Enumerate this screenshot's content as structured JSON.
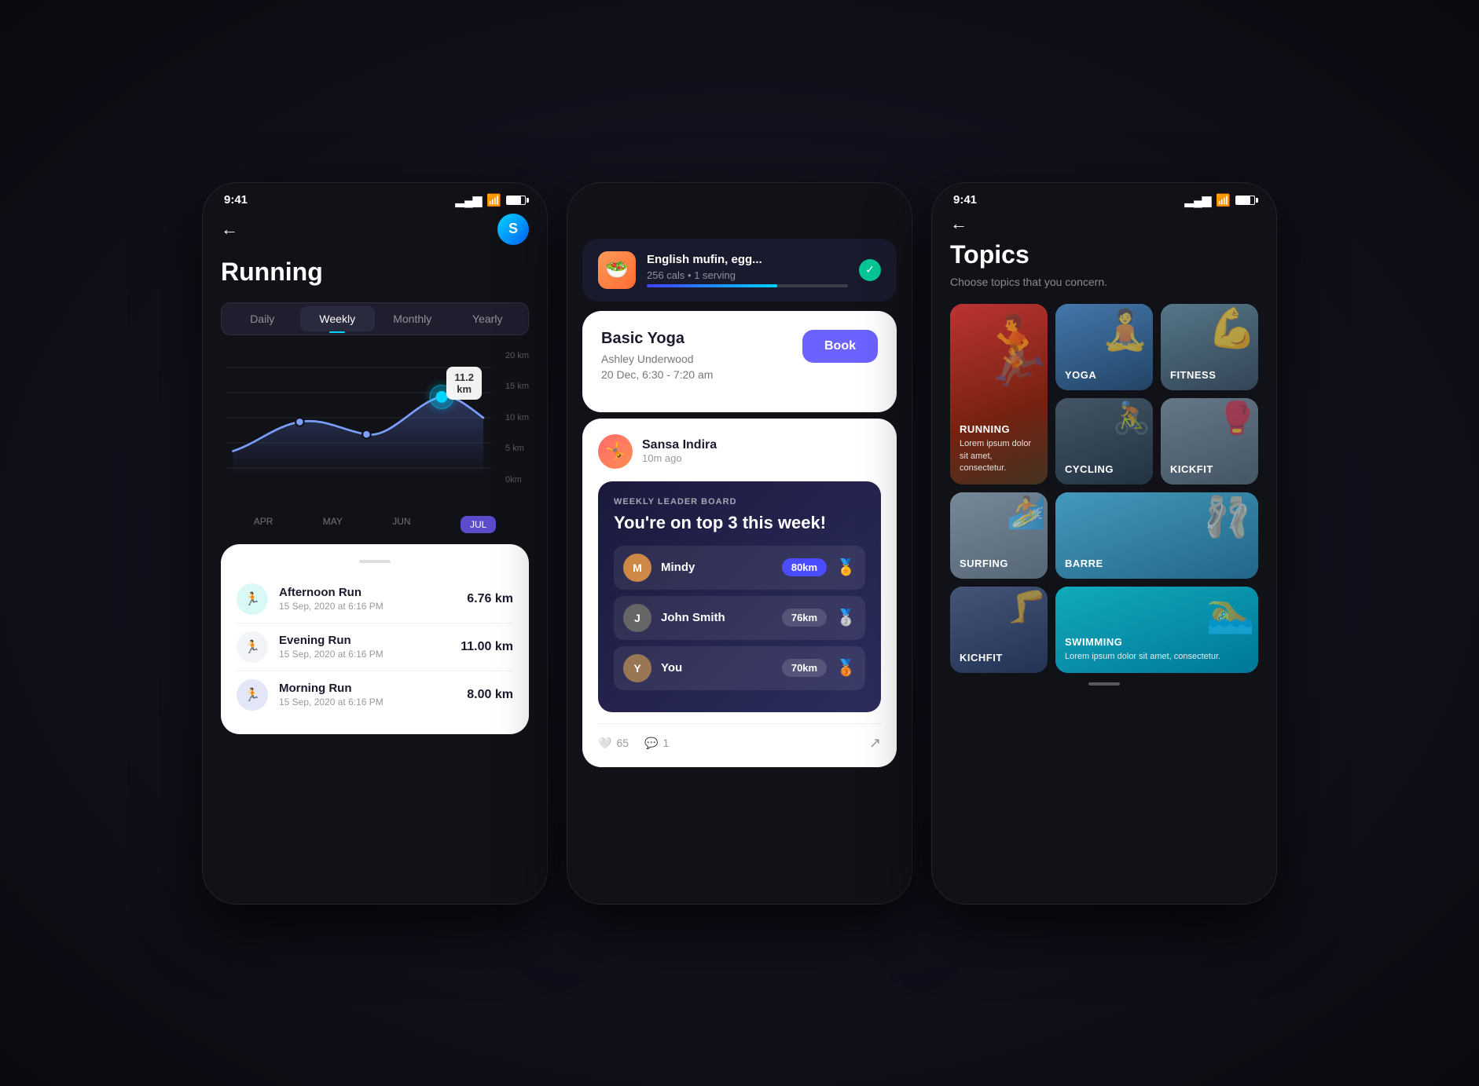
{
  "left_phone": {
    "status_time": "9:41",
    "back_label": "←",
    "logo_text": "S",
    "page_title": "Running",
    "tabs": [
      {
        "label": "Daily",
        "active": false
      },
      {
        "label": "Weekly",
        "active": true
      },
      {
        "label": "Monthly",
        "active": false
      },
      {
        "label": "Yearly",
        "active": false
      }
    ],
    "chart": {
      "tooltip_value": "11.2",
      "tooltip_unit": "km",
      "y_labels": [
        "20 km",
        "15 km",
        "10 km",
        "5 km",
        "0km"
      ],
      "x_labels": [
        "APR",
        "MAY",
        "JUN",
        "JUL"
      ]
    },
    "run_list": [
      {
        "name": "Afternoon Run",
        "date": "15 Sep, 2020 at 6:16 PM",
        "distance": "6.76 km",
        "color": "#00d4c8"
      },
      {
        "name": "Evening Run",
        "date": "15 Sep, 2020 at 6:16 PM",
        "distance": "11.00 km",
        "color": "#aab4cc"
      },
      {
        "name": "Morning Run",
        "date": "15 Sep, 2020 at 6:16 PM",
        "distance": "8.00 km",
        "color": "#4455cc"
      }
    ]
  },
  "center_phone": {
    "food_card": {
      "name": "English mufin, egg...",
      "meta": "256 cals • 1 serving",
      "progress": 65
    },
    "yoga_card": {
      "title": "Basic Yoga",
      "instructor": "Ashley Underwood",
      "time": "20 Dec, 6:30 - 7:20 am",
      "book_label": "Book"
    },
    "social_post": {
      "user_name": "Sansa Indira",
      "time_ago": "10m ago",
      "leaderboard_label": "WEEKLY LEADER BOARD",
      "leaderboard_title": "You're on top 3 this week!",
      "leaderboard_items": [
        {
          "name": "Mindy",
          "km": "80km",
          "medal": "🏅",
          "rank": 1
        },
        {
          "name": "John Smith",
          "km": "76km",
          "medal": "🥈",
          "rank": 2
        },
        {
          "name": "You",
          "km": "70km",
          "medal": "🥉",
          "rank": 3
        }
      ],
      "likes": "65",
      "comments": "1"
    }
  },
  "right_phone": {
    "status_time": "9:41",
    "back_label": "←",
    "page_title": "Topics",
    "subtitle": "Choose topics that you concern.",
    "topics": [
      {
        "id": "running",
        "label": "RUNNING",
        "desc": "Lorem ipsum dolor sit amet, consectetur.",
        "size": "large",
        "col": 1
      },
      {
        "id": "yoga",
        "label": "YOGA",
        "desc": "",
        "size": "small",
        "col": 2
      },
      {
        "id": "fitness",
        "label": "FITNESS",
        "desc": "",
        "size": "small",
        "col": 3
      },
      {
        "id": "cycling",
        "label": "CYCLING",
        "desc": "",
        "size": "small",
        "col": 1
      },
      {
        "id": "kickfit",
        "label": "KICKFIT",
        "desc": "",
        "size": "small",
        "col": 2
      },
      {
        "id": "barre",
        "label": "BARRE",
        "desc": "",
        "size": "small",
        "col": 3
      },
      {
        "id": "surfing",
        "label": "SURFING",
        "desc": "",
        "size": "small",
        "col": 1
      },
      {
        "id": "kichfit",
        "label": "KICHFIT",
        "desc": "",
        "size": "small",
        "col": 2
      },
      {
        "id": "swimming",
        "label": "SWIMMING",
        "desc": "Lorem ipsum dolor sit amet, consectetur.",
        "size": "large",
        "col": 3
      }
    ]
  }
}
